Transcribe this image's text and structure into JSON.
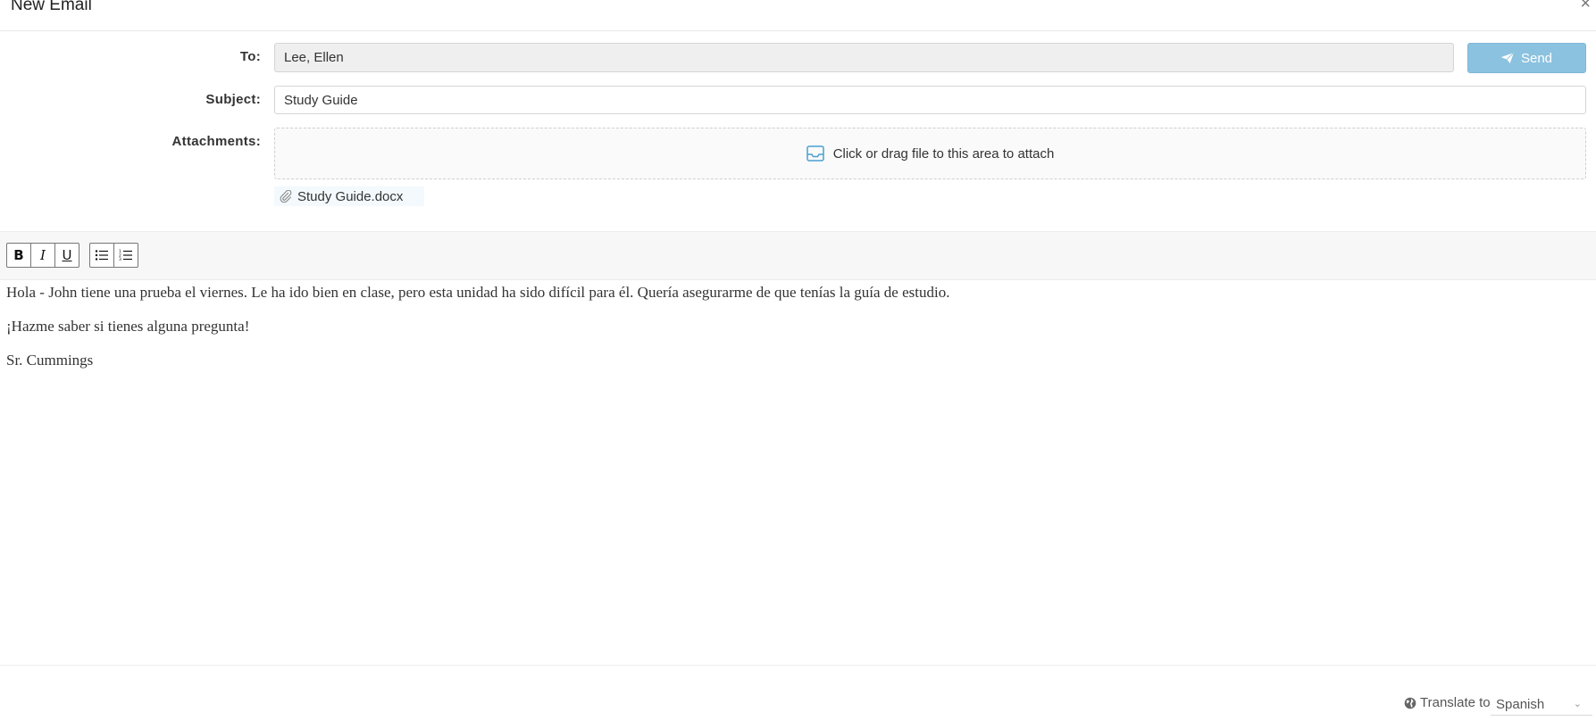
{
  "window": {
    "title": "New Email",
    "close_glyph": "×"
  },
  "form": {
    "to_label": "To:",
    "to_value": "Lee, Ellen",
    "subject_label": "Subject:",
    "subject_value": "Study Guide",
    "attachments_label": "Attachments:",
    "dropzone_text": "Click or drag file to this area to attach",
    "attachments": [
      {
        "name": "Study Guide.docx",
        "icon": "paperclip-icon"
      }
    ]
  },
  "send_button": {
    "label": "Send",
    "icon": "paper-plane-icon",
    "color": "#8bc2df"
  },
  "toolbar": {
    "bold": "B",
    "italic": "I",
    "underline": "U",
    "bullet_list_icon": "bullet-list-icon",
    "numbered_list_icon": "numbered-list-icon"
  },
  "message": {
    "paragraphs": [
      "Hola - John tiene una prueba el viernes. Le ha ido bien en clase, pero esta unidad ha sido difícil para él. Quería asegurarme de que tenías la guía de estudio.",
      "¡Hazme saber si tienes alguna pregunta!",
      "Sr. Cummings"
    ]
  },
  "translate": {
    "label": "Translate to",
    "icon": "globe-icon",
    "selected_language": "Spanish"
  }
}
